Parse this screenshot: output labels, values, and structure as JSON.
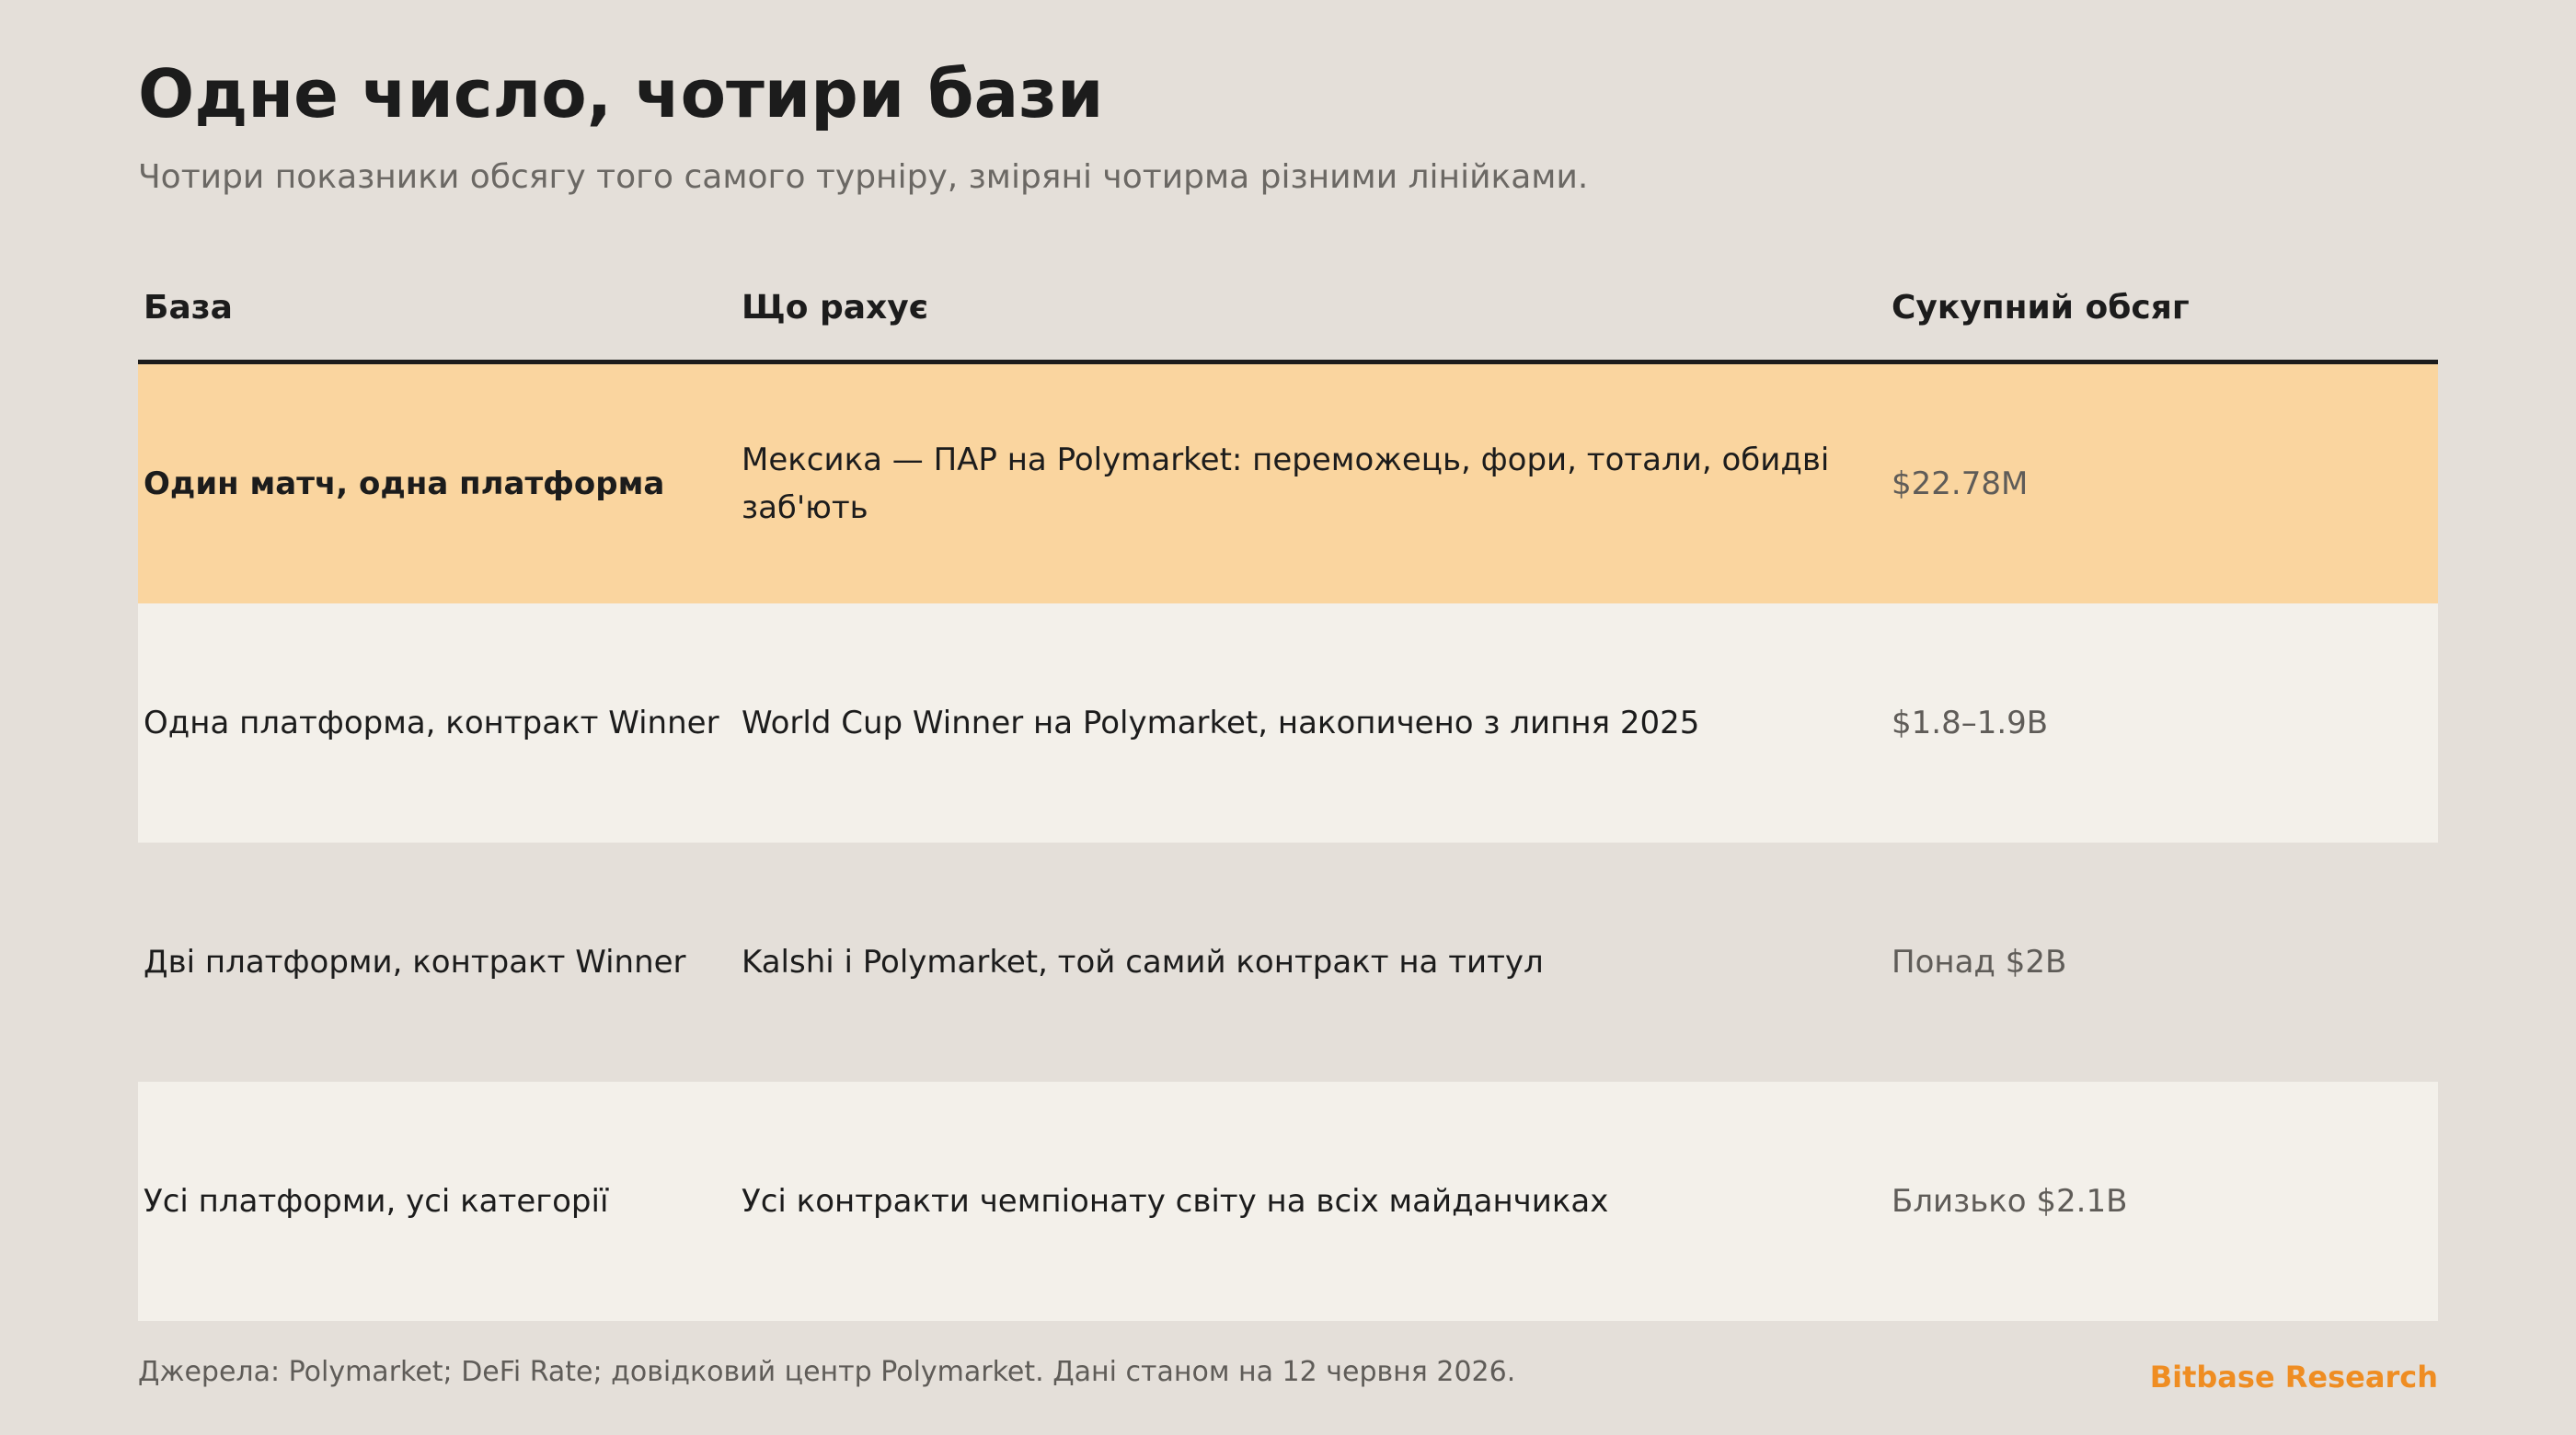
{
  "title": "Одне число, чотири бази",
  "subtitle": "Чотири показники обсягу того самого турніру, зміряні чотирма різними лінійками.",
  "table": {
    "headers": [
      "База",
      "Що рахує",
      "Сукупний обсяг"
    ],
    "rows": [
      {
        "base": "Один матч, одна платформа",
        "counts": "Мексика — ПАР на Polymarket: переможець, фори, тотали, обидві заб'ють",
        "volume": "$22.78M"
      },
      {
        "base": "Одна платформа, контракт Winner",
        "counts": "World Cup Winner на Polymarket, накопичено з липня 2025",
        "volume": "$1.8–1.9B"
      },
      {
        "base": "Дві платформи, контракт Winner",
        "counts": "Kalshi і Polymarket, той самий контракт на титул",
        "volume": "Понад $2B"
      },
      {
        "base": "Усі платформи, усі категорії",
        "counts": "Усі контракти чемпіонату світу на всіх майданчиках",
        "volume": "Близько $2.1B"
      }
    ]
  },
  "footer": {
    "source": "Джерела: Polymarket; DeFi Rate; довідковий центр Polymarket. Дані станом на 12 червня 2026.",
    "brand": "Bitbase Research"
  },
  "colors": {
    "background": "#e4dfd9",
    "highlight_row": "#fad59f",
    "light_row": "#f3f0ea",
    "accent": "#ef8d22",
    "text": "#1c1c1c",
    "muted": "#5f5c58"
  }
}
